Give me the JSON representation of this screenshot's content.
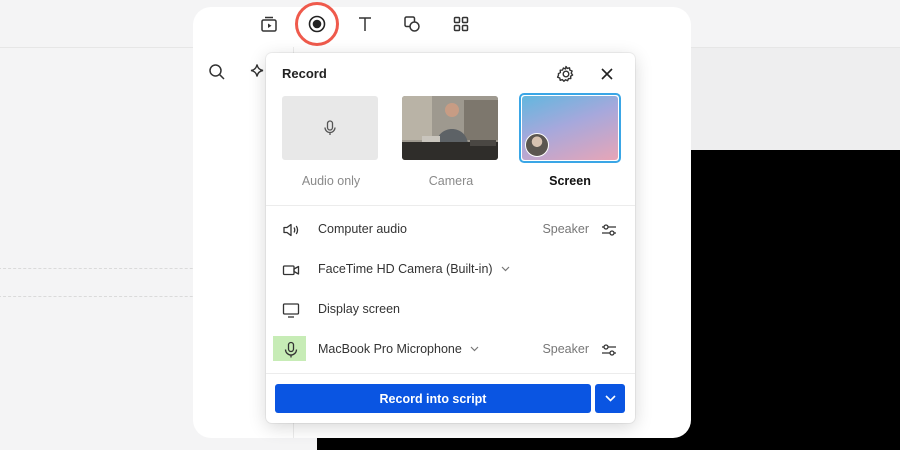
{
  "popup": {
    "title": "Record",
    "modes": [
      {
        "label": "Audio only",
        "selected": false
      },
      {
        "label": "Camera",
        "selected": false
      },
      {
        "label": "Screen",
        "selected": true
      }
    ],
    "rows": [
      {
        "icon": "speaker-icon",
        "label": "Computer audio",
        "right": "Speaker"
      },
      {
        "icon": "camera-icon",
        "label": "FaceTime HD Camera (Built-in)"
      },
      {
        "icon": "monitor-icon",
        "label": "Display screen"
      },
      {
        "icon": "microphone-icon",
        "label": "MacBook Pro Microphone",
        "right": "Speaker"
      }
    ],
    "primary_button": "Record into script"
  },
  "colors": {
    "accent": "#0a55e2",
    "record_highlight": "#ef5a4c",
    "selected_border": "#3aa6e6"
  },
  "toolbar_icons": [
    "media-icon",
    "record-icon",
    "text-icon",
    "shapes-icon",
    "grid-icon"
  ]
}
